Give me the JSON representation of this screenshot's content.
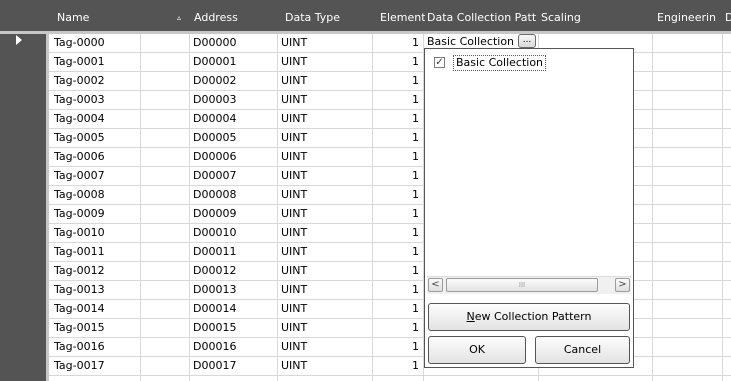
{
  "header": {
    "columns": [
      {
        "key": "name",
        "label": "Name"
      },
      {
        "key": "address",
        "label": "Address"
      },
      {
        "key": "data_type",
        "label": "Data Type"
      },
      {
        "key": "element",
        "label": "Element"
      },
      {
        "key": "dcp",
        "label": "Data Collection Patt"
      },
      {
        "key": "scaling",
        "label": "Scaling"
      },
      {
        "key": "engineering",
        "label": "Engineerin"
      },
      {
        "key": "extra",
        "label": "D"
      }
    ],
    "sort_indicator": "▵"
  },
  "rows": [
    {
      "name": "Tag-0000",
      "address": "D00000",
      "data_type": "UINT",
      "element": "1"
    },
    {
      "name": "Tag-0001",
      "address": "D00001",
      "data_type": "UINT",
      "element": "1"
    },
    {
      "name": "Tag-0002",
      "address": "D00002",
      "data_type": "UINT",
      "element": "1"
    },
    {
      "name": "Tag-0003",
      "address": "D00003",
      "data_type": "UINT",
      "element": "1"
    },
    {
      "name": "Tag-0004",
      "address": "D00004",
      "data_type": "UINT",
      "element": "1"
    },
    {
      "name": "Tag-0005",
      "address": "D00005",
      "data_type": "UINT",
      "element": "1"
    },
    {
      "name": "Tag-0006",
      "address": "D00006",
      "data_type": "UINT",
      "element": "1"
    },
    {
      "name": "Tag-0007",
      "address": "D00007",
      "data_type": "UINT",
      "element": "1"
    },
    {
      "name": "Tag-0008",
      "address": "D00008",
      "data_type": "UINT",
      "element": "1"
    },
    {
      "name": "Tag-0009",
      "address": "D00009",
      "data_type": "UINT",
      "element": "1"
    },
    {
      "name": "Tag-0010",
      "address": "D00010",
      "data_type": "UINT",
      "element": "1"
    },
    {
      "name": "Tag-0011",
      "address": "D00011",
      "data_type": "UINT",
      "element": "1"
    },
    {
      "name": "Tag-0012",
      "address": "D00012",
      "data_type": "UINT",
      "element": "1"
    },
    {
      "name": "Tag-0013",
      "address": "D00013",
      "data_type": "UINT",
      "element": "1"
    },
    {
      "name": "Tag-0014",
      "address": "D00014",
      "data_type": "UINT",
      "element": "1"
    },
    {
      "name": "Tag-0015",
      "address": "D00015",
      "data_type": "UINT",
      "element": "1"
    },
    {
      "name": "Tag-0016",
      "address": "D00016",
      "data_type": "UINT",
      "element": "1"
    },
    {
      "name": "Tag-0017",
      "address": "D00017",
      "data_type": "UINT",
      "element": "1"
    }
  ],
  "selected_row": {
    "dcp_value": "Basic Collection",
    "ellipsis": "..."
  },
  "popup": {
    "items": [
      {
        "label": "Basic Collection",
        "checked": true
      }
    ],
    "check_glyph": "✓",
    "scroll_left": "<",
    "scroll_right": ">",
    "scroll_grip": "III",
    "new_pattern_button": {
      "label_first": "N",
      "label_rest": "ew Collection Pattern"
    },
    "ok_button": "OK",
    "cancel_button": "Cancel"
  },
  "icons": {
    "row_pointer": "current-row-pointer-icon",
    "checkbox": "checkbox-checked-icon"
  }
}
